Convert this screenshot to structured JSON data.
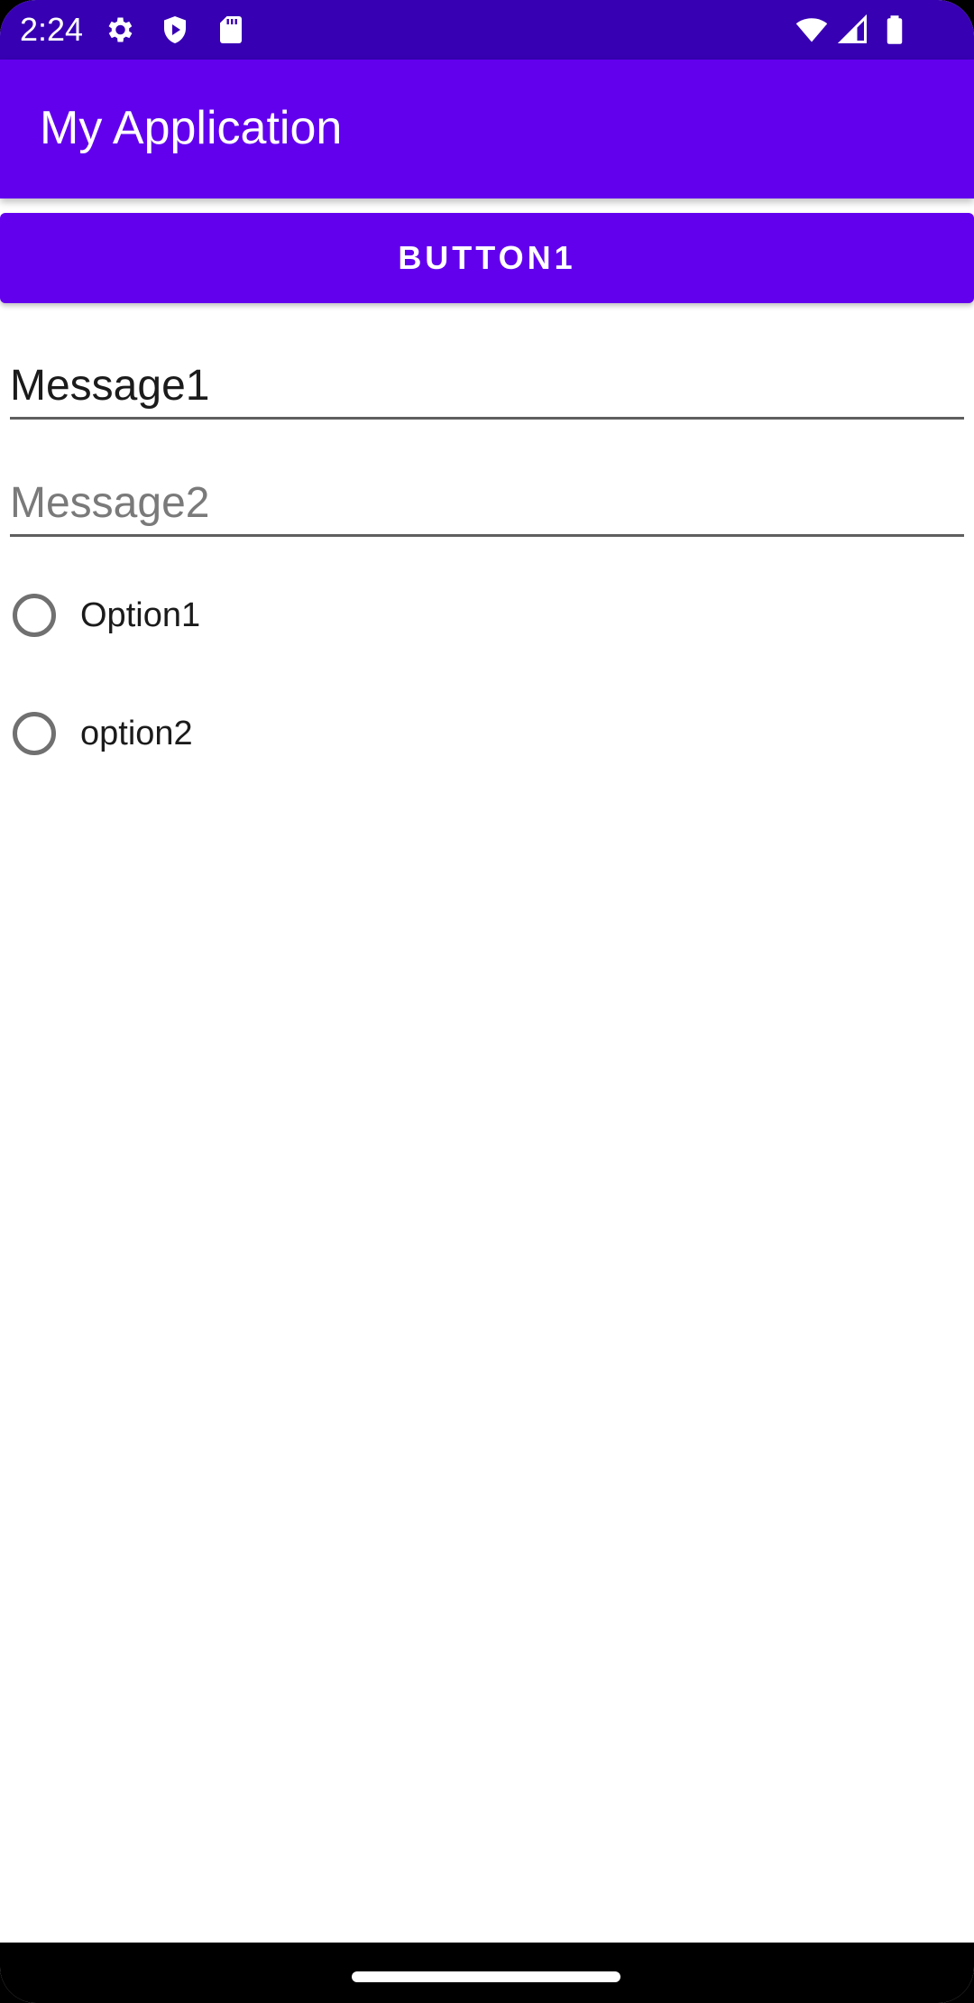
{
  "status_bar": {
    "time": "2:24",
    "left_icons": [
      "gear-icon",
      "shield-icon",
      "sd-card-icon"
    ],
    "right_icons": [
      "wifi-icon",
      "signal-icon",
      "battery-icon"
    ],
    "color": "#3700b3"
  },
  "app_bar": {
    "title": "My Application",
    "color": "#6200ee"
  },
  "main": {
    "button_label": "BUTTON1",
    "message1": {
      "value": "Message1",
      "placeholder": ""
    },
    "message2": {
      "value": "",
      "placeholder": "Message2"
    },
    "options": [
      {
        "label": "Option1",
        "checked": false
      },
      {
        "label": "option2",
        "checked": false
      }
    ]
  },
  "nav_bar": {
    "color": "#000000"
  }
}
